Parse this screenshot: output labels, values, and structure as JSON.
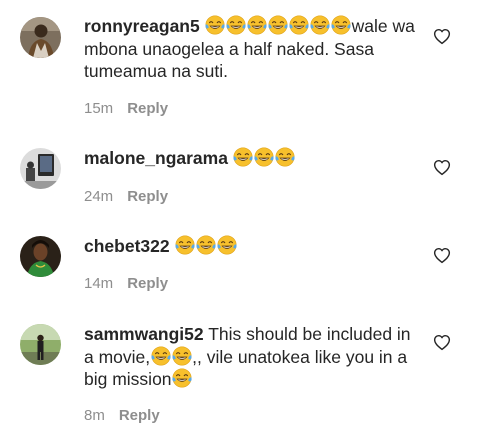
{
  "comments": [
    {
      "username": "ronnyreagan5",
      "emoji_before": 7,
      "text": "wale wa mbona unaogelea a half naked. Sasa tumeamua na suti.",
      "time": "15m",
      "reply_label": "Reply",
      "avatar_icon": "user-avatar-photo",
      "like_icon": "heart-outline-icon"
    },
    {
      "username": "malone_ngarama",
      "emoji_before": 3,
      "text": "",
      "time": "24m",
      "reply_label": "Reply",
      "avatar_icon": "user-avatar-photo",
      "like_icon": "heart-outline-icon"
    },
    {
      "username": "chebet322",
      "emoji_before": 3,
      "text": "",
      "time": "14m",
      "reply_label": "Reply",
      "avatar_icon": "user-avatar-photo",
      "like_icon": "heart-outline-icon"
    },
    {
      "username": "sammwangi52",
      "text_part1": "This should be included in a movie,",
      "text_part2": ",, vile unatokea like you in a big mission",
      "time": "8m",
      "reply_label": "Reply",
      "avatar_icon": "user-avatar-photo",
      "like_icon": "heart-outline-icon"
    }
  ],
  "emoji_name": "face-with-tears-of-joy-emoji",
  "colors": {
    "text": "#262626",
    "secondary": "#8e8e8e",
    "emoji_face": "#f7c02c",
    "emoji_tears": "#5aa9e6"
  }
}
